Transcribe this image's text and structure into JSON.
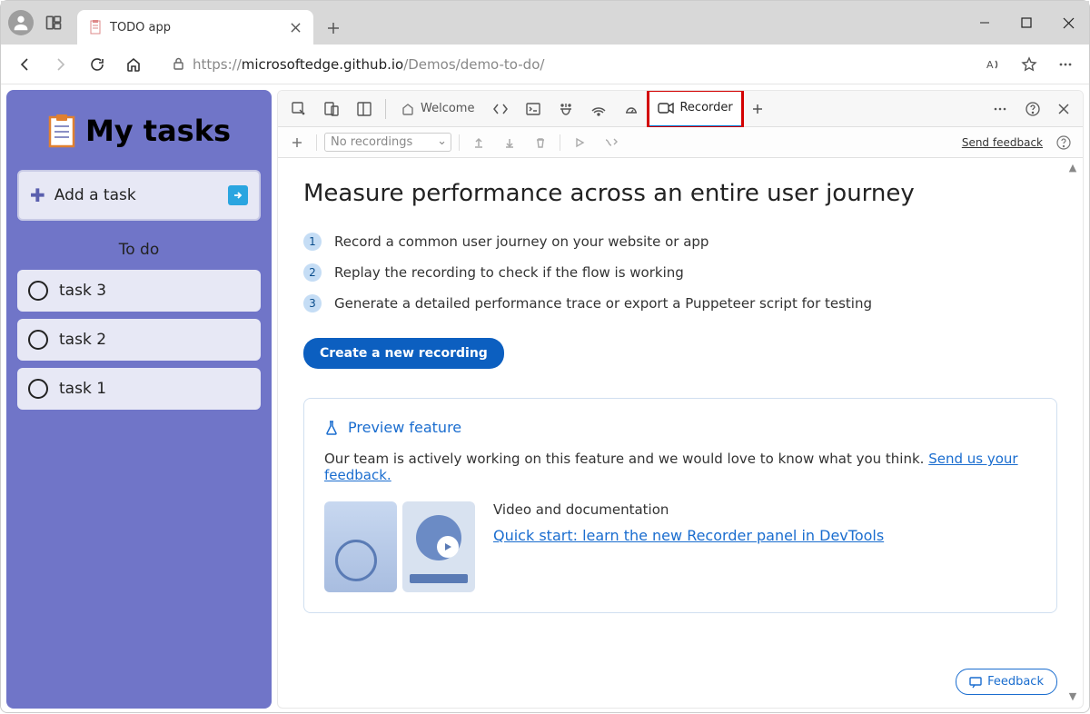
{
  "browser": {
    "tab_title": "TODO app",
    "url_prefix": "https://",
    "url_host": "microsoftedge.github.io",
    "url_path": "/Demos/demo-to-do/"
  },
  "todo": {
    "title": "My tasks",
    "add_label": "Add a task",
    "section": "To do",
    "tasks": [
      "task 3",
      "task 2",
      "task 1"
    ]
  },
  "devtools": {
    "tabs": {
      "welcome": "Welcome",
      "recorder": "Recorder"
    },
    "toolbar": {
      "dropdown": "No recordings",
      "send_feedback": "Send feedback"
    },
    "content": {
      "heading": "Measure performance across an entire user journey",
      "steps": [
        "Record a common user journey on your website or app",
        "Replay the recording to check if the flow is working",
        "Generate a detailed performance trace or export a Puppeteer script for testing"
      ],
      "create_btn": "Create a new recording",
      "preview": {
        "title": "Preview feature",
        "text": "Our team is actively working on this feature and we would love to know what you think. ",
        "link": "Send us your feedback.",
        "video_heading": "Video and documentation",
        "video_link": "Quick start: learn the new Recorder panel in DevTools"
      },
      "feedback_btn": "Feedback"
    }
  }
}
